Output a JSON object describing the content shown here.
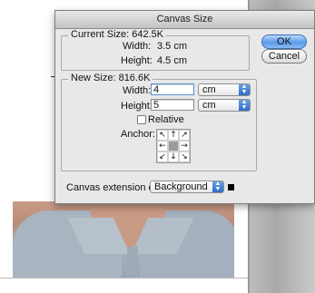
{
  "dialog": {
    "title": "Canvas Size"
  },
  "current_size": {
    "heading": "Current Size: 642.5K",
    "width_label": "Width:",
    "width_value": "3.5 cm",
    "height_label": "Height:",
    "height_value": "4.5 cm"
  },
  "new_size": {
    "heading": "New Size: 816.6K",
    "width_label": "Width:",
    "width_value": "4",
    "width_unit": "cm",
    "height_label": "Height:",
    "height_value": "5",
    "height_unit": "cm",
    "relative_label": "Relative",
    "relative_checked": false,
    "anchor_label": "Anchor:",
    "anchor_arrows": [
      "↖",
      "↑",
      "↗",
      "←",
      "",
      "→",
      "↙",
      "↓",
      "↘"
    ]
  },
  "extension": {
    "label": "Canvas extension color:",
    "value": "Background",
    "swatch_color": "#000000"
  },
  "buttons": {
    "ok": "OK",
    "cancel": "Cancel"
  },
  "colors": {
    "accent": "#3e7fd6",
    "dialog_bg": "#e8e8e8"
  }
}
